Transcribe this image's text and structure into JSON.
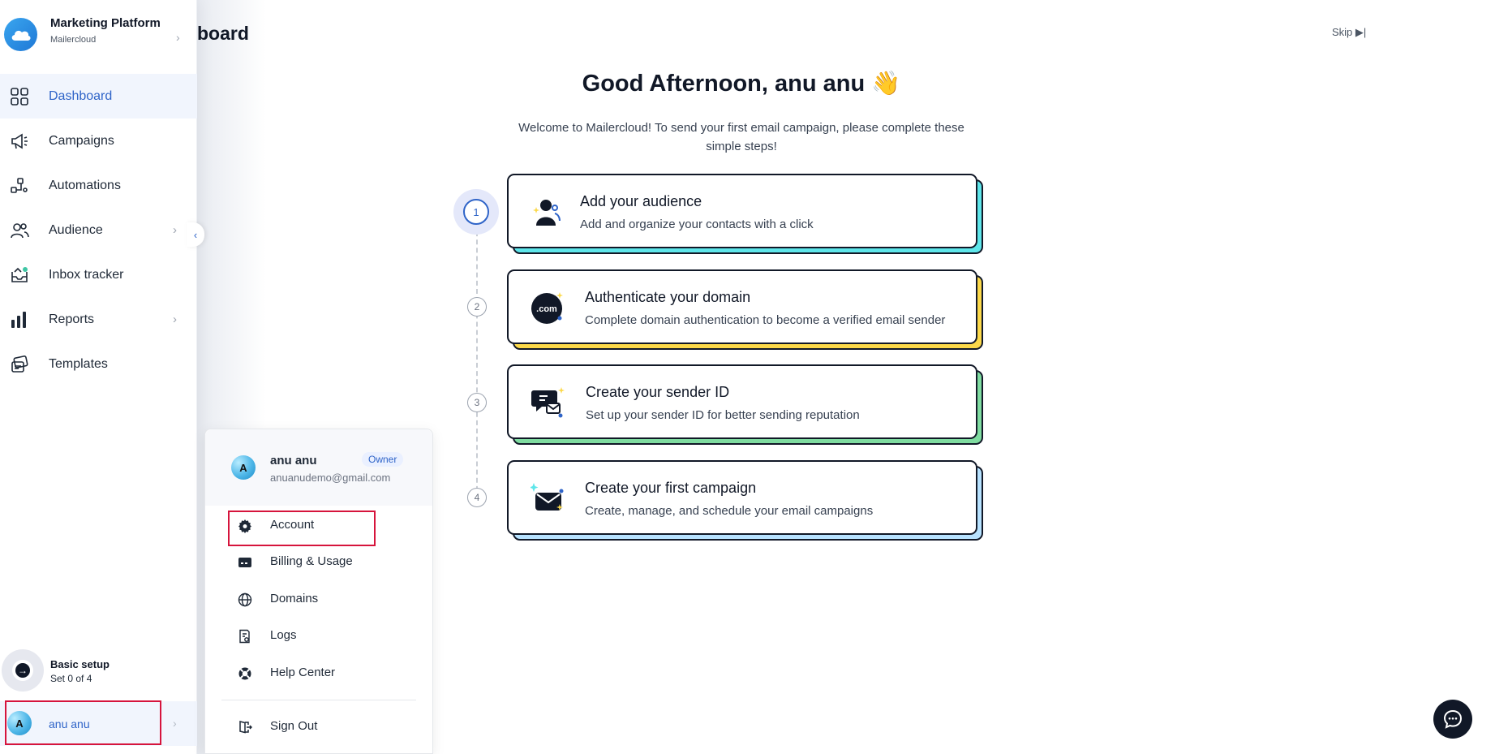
{
  "brand": {
    "title": "Marketing Platform",
    "subtitle": "Mailercloud"
  },
  "nav": [
    {
      "label": "Dashboard",
      "icon": "dashboard-grid-icon",
      "active": true
    },
    {
      "label": "Campaigns",
      "icon": "megaphone-icon"
    },
    {
      "label": "Automations",
      "icon": "workflow-icon"
    },
    {
      "label": "Audience",
      "icon": "users-icon",
      "has_submenu": true
    },
    {
      "label": "Inbox tracker",
      "icon": "inbox-icon"
    },
    {
      "label": "Reports",
      "icon": "bar-chart-icon",
      "has_submenu": true
    },
    {
      "label": "Templates",
      "icon": "templates-icon"
    }
  ],
  "page_heading": "board",
  "skip_label": "Skip ▶|",
  "basic_setup": {
    "title": "Basic setup",
    "progress": "Set 0 of 4"
  },
  "user": {
    "name": "anu anu",
    "initial": "A",
    "email": "anuanudemo@gmail.com",
    "role": "Owner"
  },
  "greeting": "Good Afternoon, anu anu 👋",
  "welcome": "Welcome to Mailercloud! To send your first email campaign, please complete these simple steps!",
  "steps": [
    {
      "num": "1",
      "title": "Add your audience",
      "desc": "Add and organize your contacts with a click",
      "accent": "#5ee6ea"
    },
    {
      "num": "2",
      "title": "Authenticate your domain",
      "desc": "Complete domain authentication to become a verified email sender",
      "accent": "#fcd94a"
    },
    {
      "num": "3",
      "title": "Create your sender ID",
      "desc": "Set up your sender ID for better sending reputation",
      "accent": "#7fdca0"
    },
    {
      "num": "4",
      "title": "Create your first campaign",
      "desc": "Create, manage, and schedule your email campaigns",
      "accent": "#b7e2ff"
    }
  ],
  "menu": {
    "items": [
      {
        "label": "Account",
        "icon": "gear-icon"
      },
      {
        "label": "Billing & Usage",
        "icon": "billing-card-icon"
      },
      {
        "label": "Domains",
        "icon": "globe-icon"
      },
      {
        "label": "Logs",
        "icon": "logs-icon"
      },
      {
        "label": "Help Center",
        "icon": "lifebuoy-icon"
      }
    ],
    "sign_out": "Sign Out"
  },
  "colors": {
    "accent": "#2f64c8",
    "highlight": "#d6143c",
    "dark": "#111827"
  }
}
